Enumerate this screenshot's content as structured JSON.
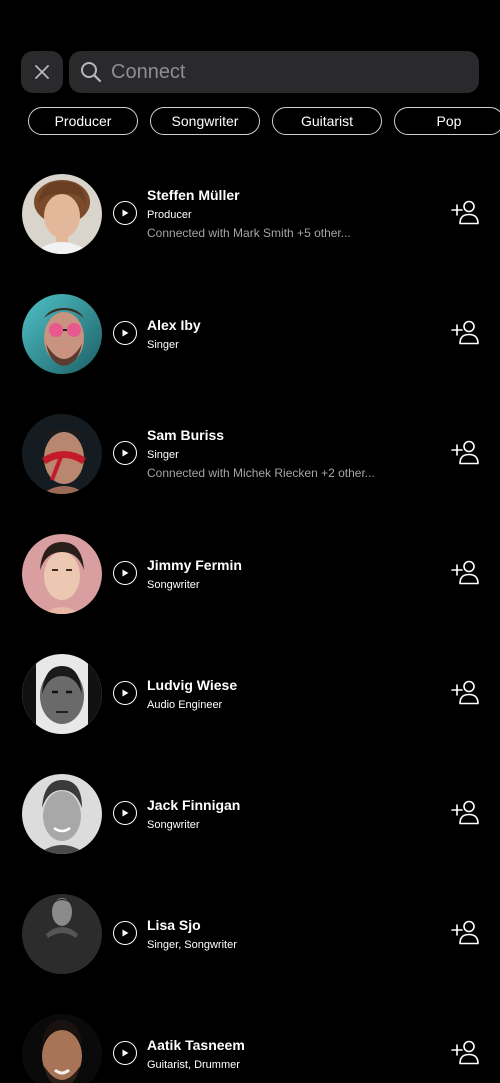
{
  "search": {
    "placeholder": "Connect"
  },
  "filters": [
    "Producer",
    "Songwriter",
    "Guitarist",
    "Pop"
  ],
  "people": [
    {
      "name": "Steffen Müller",
      "role": "Producer",
      "connection": "Connected with Mark Smith +5 other..."
    },
    {
      "name": "Alex Iby",
      "role": "Singer",
      "connection": ""
    },
    {
      "name": "Sam Buriss",
      "role": "Singer",
      "connection": "Connected with Michek Riecken +2 other..."
    },
    {
      "name": "Jimmy Fermin",
      "role": "Songwriter",
      "connection": ""
    },
    {
      "name": "Ludvig Wiese",
      "role": "Audio Engineer",
      "connection": ""
    },
    {
      "name": "Jack Finnigan",
      "role": "Songwriter",
      "connection": ""
    },
    {
      "name": "Lisa Sjo",
      "role": "Singer, Songwriter",
      "connection": ""
    },
    {
      "name": "Aatik Tasneem",
      "role": "Guitarist, Drummer",
      "connection": ""
    }
  ],
  "icons": {
    "close": "close-icon",
    "search": "search-icon",
    "play": "play-icon",
    "add": "add-person-icon"
  }
}
